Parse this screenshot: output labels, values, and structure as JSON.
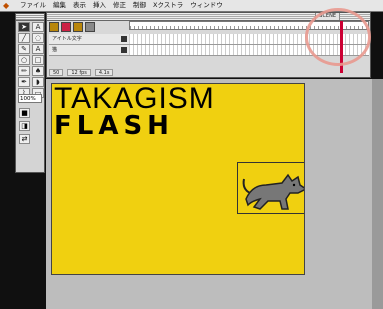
{
  "menubar": {
    "items": [
      "ファイル",
      "編集",
      "表示",
      "挿入",
      "修正",
      "制御",
      "Xクストラ",
      "ウィンドウ"
    ]
  },
  "toolbox": {
    "zoom": "100%"
  },
  "timeline": {
    "scene": "SCENE",
    "layers": [
      {
        "name": "アイトル文字"
      },
      {
        "name": "猫"
      }
    ],
    "status": [
      "50",
      "12 fps",
      "4.1s"
    ]
  },
  "stage": {
    "title_line1": "TAKAGISM",
    "title_line2": "FLASH"
  },
  "colors": {
    "stage_bg": "#f0d010",
    "highlight_circle": "#e9998f"
  }
}
